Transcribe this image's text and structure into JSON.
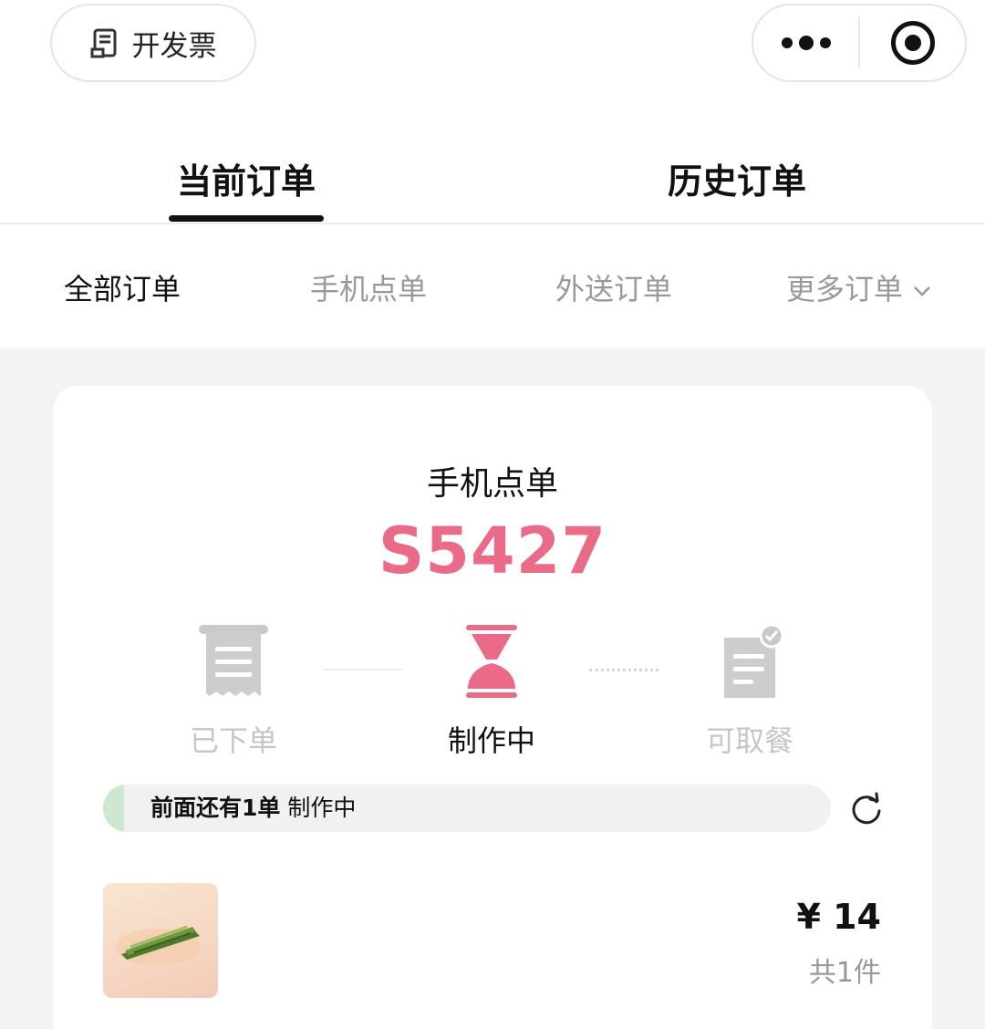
{
  "top_bar": {
    "invoice_label": "开发票"
  },
  "main_tabs": [
    {
      "label": "当前订单",
      "active": true
    },
    {
      "label": "历史订单",
      "active": false
    }
  ],
  "sub_tabs": [
    {
      "label": "全部订单",
      "active": true
    },
    {
      "label": "手机点单",
      "active": false
    },
    {
      "label": "外送订单",
      "active": false
    },
    {
      "label": "更多订单",
      "active": false
    }
  ],
  "order": {
    "type": "手机点单",
    "number": "S5427",
    "steps": [
      {
        "label": "已下单",
        "icon": "receipt-icon",
        "state": "done"
      },
      {
        "label": "制作中",
        "icon": "hourglass-icon",
        "state": "current"
      },
      {
        "label": "可取餐",
        "icon": "ready-document-check-icon",
        "state": "pending"
      }
    ],
    "queue_status_bold": "前面还有1单",
    "queue_status_rest": "制作中",
    "price": "¥ 14",
    "quantity": "共1件"
  },
  "colors": {
    "accent": "#ea6b87",
    "inactive_step": "#c6c6c6",
    "progress_fill": "#cde8cf"
  }
}
